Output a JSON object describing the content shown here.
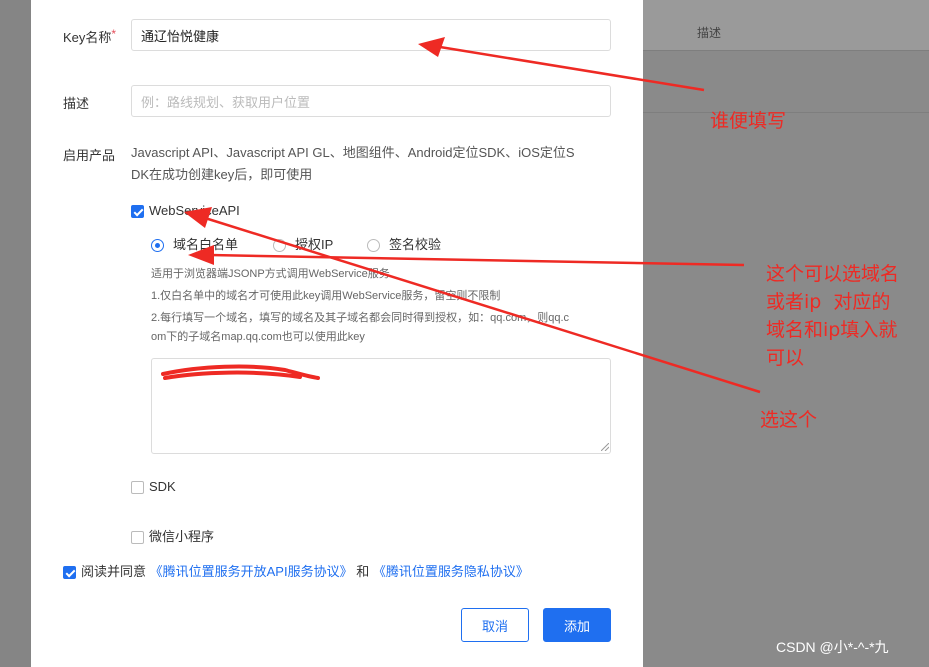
{
  "background": {
    "column_header": "描述"
  },
  "form": {
    "key_name_label": "Key名称",
    "key_name_required": "*",
    "key_name_value": "通辽怡悦健康",
    "desc_label": "描述",
    "desc_placeholder": "例：路线规划、获取用户位置",
    "products_label": "启用产品",
    "products_text_line1": "Javascript API、Javascript API GL、地图组件、Android定位SDK、iOS定位S",
    "products_text_line2": "DK在成功创建key后，即可使用",
    "webservice_label": "WebServiceAPI",
    "radio_options": [
      "域名白名单",
      "授权IP",
      "签名校验"
    ],
    "help_line1": "适用于浏览器端JSONP方式调用WebService服务",
    "help_line2": "1.仅白名单中的域名才可使用此key调用WebService服务，留空则不限制",
    "help_line3": "2.每行填写一个域名，填写的域名及其子域名都会同时得到授权，如：qq.com，则qq.c",
    "help_line4": "om下的子域名map.qq.com也可以使用此key",
    "sdk_label": "SDK",
    "miniprogram_label": "微信小程序",
    "agree_prefix": "阅读并同意",
    "agree_link1": "《腾讯位置服务开放API服务协议》",
    "agree_mid": "和",
    "agree_link2": "《腾讯位置服务隐私协议》",
    "cancel_button": "取消",
    "add_button": "添加"
  },
  "annotations": {
    "note1": "谁便填写",
    "note2_line1": "这个可以选域名",
    "note2_line2": "或者ip  对应的",
    "note2_line3": "域名和ip填入就",
    "note2_line4": "可以",
    "note3": "选这个"
  },
  "watermark": "CSDN @小*-^-*九",
  "colors": {
    "primary": "#1f6ff0",
    "annotation_red": "#ee2a24",
    "required_red": "#e34d59"
  }
}
